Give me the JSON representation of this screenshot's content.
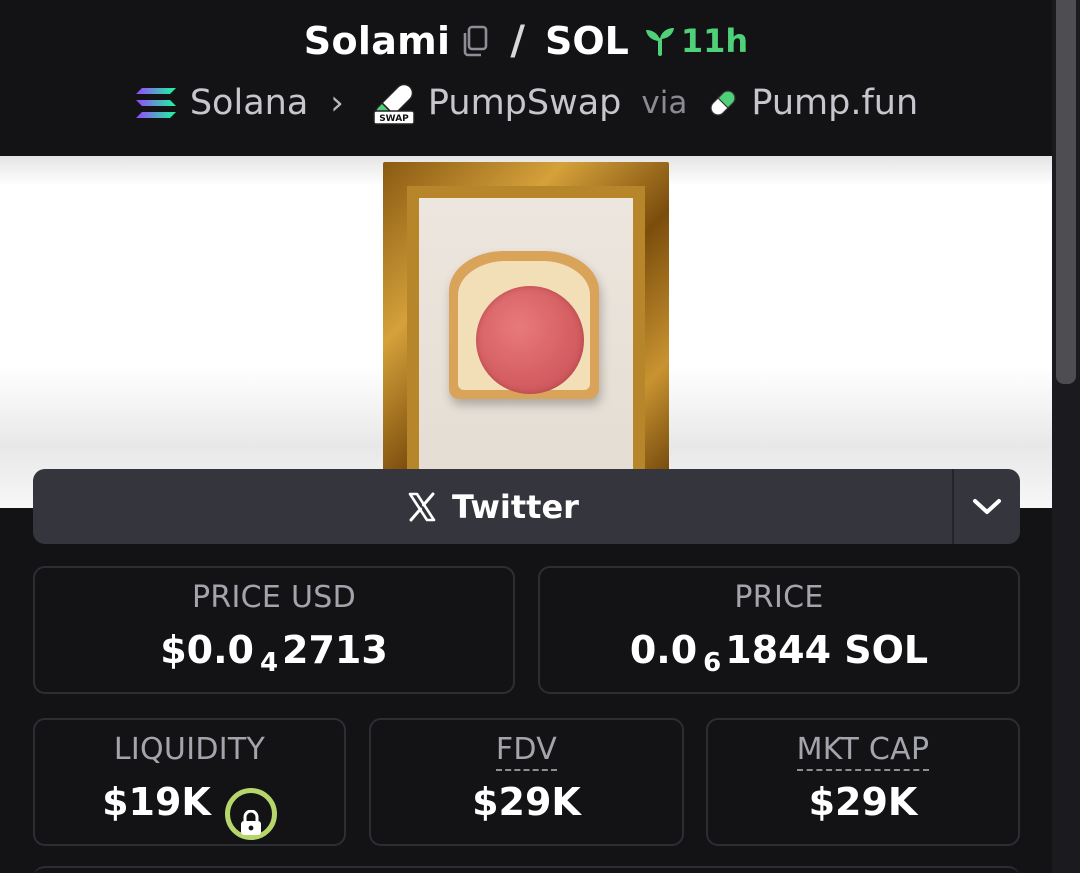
{
  "header": {
    "token_name": "Solami",
    "quote_symbol": "SOL",
    "separator": "/",
    "age": "11h",
    "chain": "Solana",
    "dex": "PumpSwap",
    "dex_badge": "SWAP",
    "via": "via",
    "launchpad": "Pump.fun"
  },
  "socials": {
    "primary_label": "Twitter"
  },
  "stats": {
    "price_usd": {
      "label": "PRICE USD",
      "prefix": "$0.0",
      "zeros": "4",
      "digits": "2713"
    },
    "price": {
      "label": "PRICE",
      "prefix": "0.0",
      "zeros": "6",
      "digits": "1844 SOL"
    },
    "liquidity": {
      "label": "LIQUIDITY",
      "value": "$19K"
    },
    "fdv": {
      "label": "FDV",
      "value": "$29K"
    },
    "mkt_cap": {
      "label": "MKT CAP",
      "value": "$29K"
    }
  },
  "colors": {
    "background": "#131316",
    "age_green": "#4fd17a",
    "lock_ring": "#b6d56b",
    "card_border": "#2d2d34",
    "socials_bar": "#35353d"
  },
  "icons": [
    "copy-icon",
    "sprout-icon",
    "solana-icon",
    "chevron-right-icon",
    "pumpswap-icon",
    "pill-icon",
    "x-icon",
    "chevron-down-icon",
    "lock-icon"
  ]
}
